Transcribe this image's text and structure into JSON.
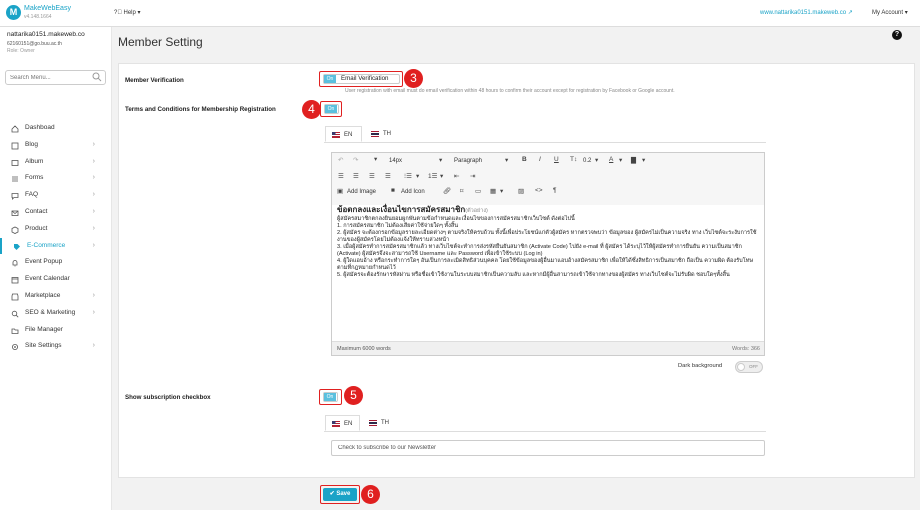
{
  "header": {
    "brand": "MakeWebEasy",
    "version": "v4.148.1664",
    "help_label": "Help",
    "site_link": "www.nattarika0151.makeweb.co",
    "account_label": "My Account"
  },
  "sidebar": {
    "user_name": "nattarika0151.makeweb.co",
    "user_email": "62160151@go.buu.ac.th",
    "user_role": "Role: Owner",
    "search_placeholder": "Search Menu...",
    "items": [
      {
        "label": "Dashboad",
        "icon": "home-icon"
      },
      {
        "label": "Blog",
        "icon": "edit-icon"
      },
      {
        "label": "Album",
        "icon": "image-icon"
      },
      {
        "label": "Forms",
        "icon": "list-icon"
      },
      {
        "label": "FAQ",
        "icon": "comment-icon"
      },
      {
        "label": "Contact",
        "icon": "envelope-icon"
      },
      {
        "label": "Product",
        "icon": "box-icon"
      },
      {
        "label": "E-Commerce",
        "icon": "tag-icon"
      },
      {
        "label": "Event Popup",
        "icon": "bell-icon"
      },
      {
        "label": "Event Calendar",
        "icon": "calendar-icon"
      },
      {
        "label": "Marketplace",
        "icon": "store-icon"
      },
      {
        "label": "SEO & Marketing",
        "icon": "search-icon"
      },
      {
        "label": "File Manager",
        "icon": "folder-icon"
      },
      {
        "label": "Site Settings",
        "icon": "gear-icon"
      }
    ]
  },
  "page": {
    "title": "Member Setting",
    "member_verification": {
      "label": "Member Verification",
      "toggle": "On",
      "toggle_text": "Email Verification",
      "hint": "User registration with email must do email verification within 48 hours to confirm their account except for registration by Facebook or Google account."
    },
    "terms": {
      "label": "Terms and Conditions for Membership Registration",
      "toggle": "On",
      "tabs": [
        "EN",
        "TH"
      ]
    },
    "editor": {
      "font_size": "14px",
      "block_format": "Paragraph",
      "line_height": "0.2",
      "add_image": "Add Image",
      "add_icon": "Add Icon",
      "content_title": "ข้อตกลงและเงื่อนไขการสมัครสมาชิก",
      "content_sub": "(ตัวอย่าง)",
      "content_intro": "ผู้สมัครสมาชิกตกลงยินยอมผูกพันตามข้อกำหนดและเงื่อนไขของการสมัครสมาชิกเว็บไซต์ ดังต่อไปนี้",
      "content_lines": [
        "1. การสมัครสมาชิก ไม่ต้องเสียค่าใช้จ่ายใดๆ ทั้งสิ้น",
        "2. ผู้สมัคร จะต้องกรอกข้อมูลรายละเอียดต่างๆ ตามจริงให้ครบถ้วน ทั้งนี้เพื่อประโยชน์แก่ตัวผู้สมัคร หากตรวจพบว่า ข้อมูลของ ผู้สมัครไม่เป็นความจริง ทาง เว็บไซต์จะระงับการใช้งานของผู้สมัครโดยไม่ต้องแจ้งให้ทราบล่วงหน้า",
        "3. เมื่อผู้สมัครทำการสมัครสมาชิกแล้ว ทางเว็บไซต์จะทำการส่งรหัสยืนยันสมาชิก (Activate Code) ไปยัง e-mail ที่ ผู้สมัคร ได้ระบุไว้ให้ผู้สมัครทำการยืนยัน ความเป็นสมาชิก (Activate) ผู้สมัครจึงจะสามารถใช้ Username และ Password เพื่อเข้าใช้ระบบ (Log in)",
        "4. ผู้ใดแอบอ้าง หรือกระทำการใดๆ อันเป็นการละเมิดสิทธิส่วนบุคคล โดยใช้ข้อมูลของผู้อื่นมาแอบอ้างสมัครสมาชิก เพื่อให้ได้ซึ่งสิทธิการเป็นสมาชิก ถือเป็น ความผิด ต้องรับโทษตามที่กฎหมายกำหนดไว้",
        "5. ผู้สมัครจะต้องรักษารหัสผ่าน หรือชื่อเข้าใช้งานในระบบสมาชิกเป็นความลับ และหากมีผู้อื่นสามารถเข้าใช้จากทางของผู้สมัคร ทางเว็บไซต์จะไม่รับผิด ชอบใดๆทั้งสิ้น"
      ],
      "max_words": "Maximum 6000 words",
      "word_count": "Words: 366",
      "dark_background_label": "Dark background",
      "dark_background_state": "OFF"
    },
    "subscription": {
      "label": "Show subscription checkbox",
      "toggle": "On",
      "tabs": [
        "EN",
        "TH"
      ],
      "input_value": "Check to subscribe to our Newsletter"
    },
    "save_label": "Save",
    "annotations": [
      "3",
      "4",
      "5",
      "6"
    ]
  },
  "colors": {
    "accent": "#1aa3c7",
    "toggle_on": "#5bc0de",
    "annotation": "#e02020"
  }
}
